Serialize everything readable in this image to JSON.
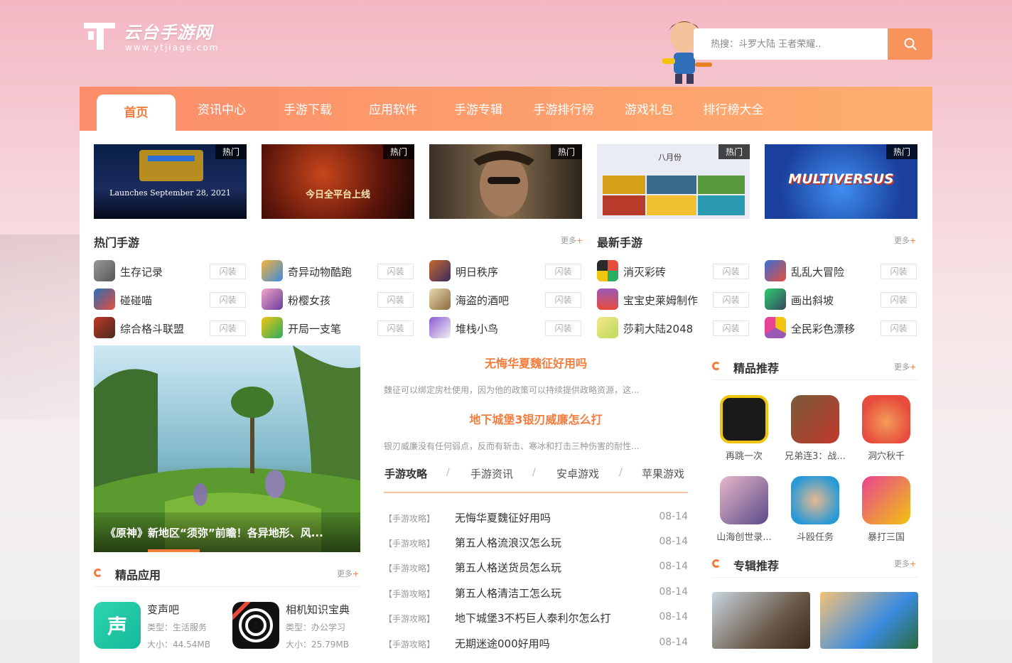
{
  "logo": {
    "name": "云台手游网",
    "url": "www.ytjiage.com"
  },
  "search": {
    "placeholder": "热搜：斗罗大陆 王者荣耀.."
  },
  "nav": [
    "首页",
    "资讯中心",
    "手游下载",
    "应用软件",
    "手游专辑",
    "手游排行榜",
    "游戏礼包",
    "排行榜大全"
  ],
  "banners": [
    {
      "tag": "热门",
      "text": "Launches September 28, 2021"
    },
    {
      "tag": "热门",
      "text": "今日全平台上线"
    },
    {
      "tag": "热门",
      "text": ""
    },
    {
      "tag": "热门",
      "text": "八月份"
    },
    {
      "tag": "热门",
      "text": "MULTIVERSUS"
    }
  ],
  "hot_games": {
    "title": "热门手游",
    "more": "更多",
    "more_plus": "+",
    "items": [
      {
        "name": "生存记录",
        "btn": "闪装"
      },
      {
        "name": "奇异动物酷跑",
        "btn": "闪装"
      },
      {
        "name": "明日秩序",
        "btn": "闪装"
      },
      {
        "name": "碰碰喵",
        "btn": "闪装"
      },
      {
        "name": "粉樱女孩",
        "btn": "闪装"
      },
      {
        "name": "海盗的酒吧",
        "btn": "闪装"
      },
      {
        "name": "综合格斗联盟",
        "btn": "闪装"
      },
      {
        "name": "开局一支笔",
        "btn": "闪装"
      },
      {
        "name": "堆栈小鸟",
        "btn": "闪装"
      }
    ]
  },
  "new_games": {
    "title": "最新手游",
    "more": "更多",
    "more_plus": "+",
    "items": [
      {
        "name": "消灭彩砖",
        "btn": "闪装"
      },
      {
        "name": "乱乱大冒险",
        "btn": "闪装"
      },
      {
        "name": "宝宝史莱姆制作",
        "btn": "闪装"
      },
      {
        "name": "画出斜坡",
        "btn": "闪装"
      },
      {
        "name": "莎莉大陆2048",
        "btn": "闪装"
      },
      {
        "name": "全民彩色漂移",
        "btn": "闪装"
      }
    ]
  },
  "feature": {
    "caption": "《原神》新地区“须弥”前瞻！各异地形、风..."
  },
  "headlines": [
    {
      "title": "无悔华夏魏征好用吗",
      "summary": "魏征可以绑定房杜使用，因为他的政策可以持续提供政略资源，这..."
    },
    {
      "title": "地下城堡3银刃威廉怎么打",
      "summary": "银刃威廉没有任何弱点，反而有斩击、寒冰和打击三种伤害的耐性..."
    }
  ],
  "tabs": [
    "手游攻略",
    "手游资讯",
    "安卓游戏",
    "苹果游戏"
  ],
  "tab_sep": "/",
  "news": [
    {
      "cat": "【手游攻略】",
      "title": "无悔华夏魏征好用吗",
      "date": "08-14"
    },
    {
      "cat": "【手游攻略】",
      "title": "第五人格流浪汉怎么玩",
      "date": "08-14"
    },
    {
      "cat": "【手游攻略】",
      "title": "第五人格送货员怎么玩",
      "date": "08-14"
    },
    {
      "cat": "【手游攻略】",
      "title": "第五人格清洁工怎么玩",
      "date": "08-14"
    },
    {
      "cat": "【手游攻略】",
      "title": "地下城堡3不朽巨人泰利尔怎么打",
      "date": "08-14"
    },
    {
      "cat": "【手游攻略】",
      "title": "无期迷途000好用吗",
      "date": "08-14"
    }
  ],
  "picks": {
    "title": "精品推荐",
    "more": "更多",
    "more_plus": "+",
    "items": [
      "再跳一次",
      "兄弟连3：战...",
      "洞穴秋千",
      "山海创世录...",
      "斗殴任务",
      "暴打三国"
    ]
  },
  "albums": {
    "title": "专辑推荐",
    "more": "更多",
    "more_plus": "+"
  },
  "apps": {
    "title": "精品应用",
    "more": "更多",
    "more_plus": "+",
    "items": [
      {
        "name": "变声吧",
        "type": "类型：生活服务",
        "size": "大小：44.54MB"
      },
      {
        "name": "相机知识宝典",
        "type": "类型：办公学习",
        "size": "大小：25.79MB"
      }
    ]
  },
  "colors": {
    "accent": "#f47c3c",
    "nav_start": "#fc8d6a",
    "nav_end": "#fdae6f"
  }
}
